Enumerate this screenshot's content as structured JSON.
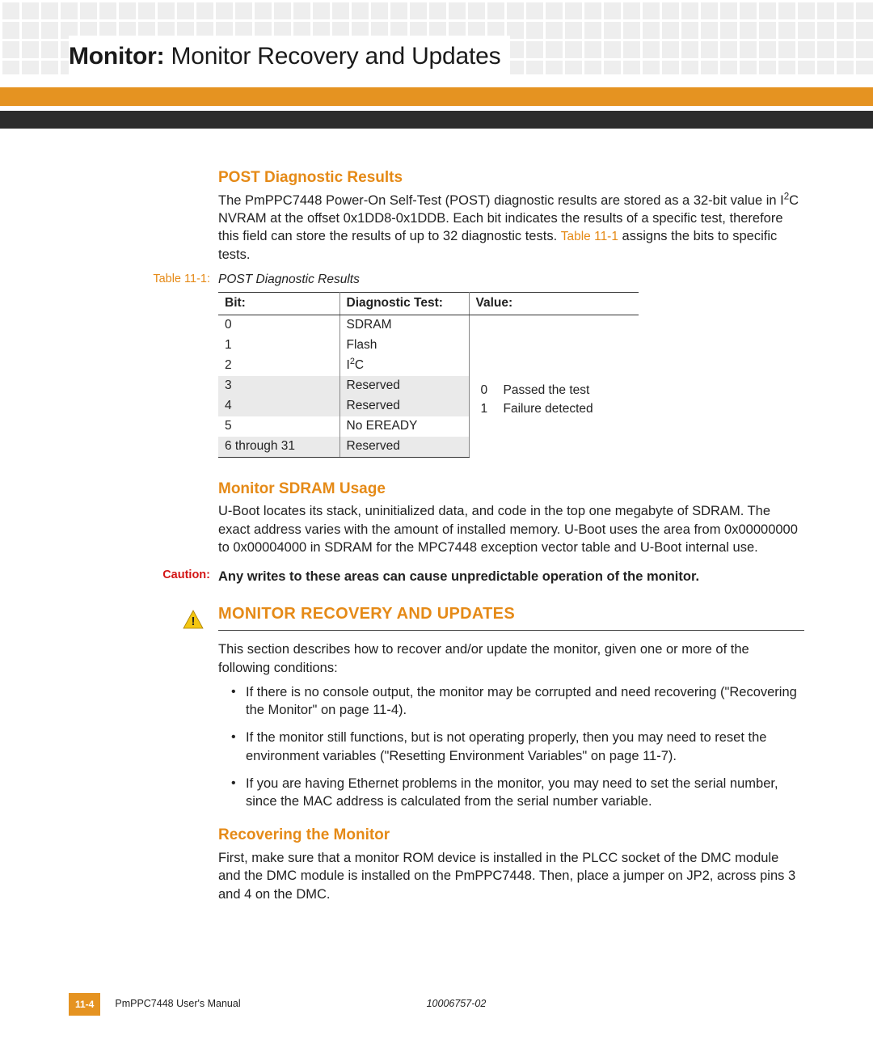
{
  "header": {
    "chapter_bold": "Monitor:",
    "chapter_light": "  Monitor Recovery and Updates"
  },
  "sections": {
    "post": {
      "title": "POST Diagnostic Results",
      "para_pre": "The PmPPC7448 Power-On Self-Test (POST) diagnostic results are stored as a 32-bit value in I",
      "para_sup": "2",
      "para_mid": "C NVRAM at the offset 0x1DD8-0x1DDB. Each bit indicates the results of a specific test, therefore this field can store the results of up to 32 diagnostic tests. ",
      "xref": "Table 11-1",
      "para_post": " assigns the bits to specific tests.",
      "table_label": "Table 11-1:",
      "table_caption": "POST Diagnostic Results",
      "headers": {
        "bit": "Bit:",
        "test": "Diagnostic Test:",
        "value": "Value:"
      },
      "rows": [
        {
          "bit": "0",
          "test": "SDRAM",
          "shade": false
        },
        {
          "bit": "1",
          "test": "Flash",
          "shade": false
        },
        {
          "bit": "2",
          "test_html": "I<sup>2</sup>C",
          "shade": false
        },
        {
          "bit": "3",
          "test": "Reserved",
          "shade": true
        },
        {
          "bit": "4",
          "test": "Reserved",
          "shade": true
        },
        {
          "bit": "5",
          "test": "No EREADY",
          "shade": false
        },
        {
          "bit": "6 through 31",
          "test": "Reserved",
          "shade": true
        }
      ],
      "values": [
        {
          "n": "0",
          "t": "Passed the test"
        },
        {
          "n": "1",
          "t": "Failure detected"
        }
      ]
    },
    "sdram": {
      "title": "Monitor SDRAM Usage",
      "para": "U-Boot locates its stack, uninitialized data, and code in the top one megabyte of SDRAM. The exact address varies with the amount of installed memory. U-Boot uses the area from 0x00000000 to 0x00004000 in SDRAM for the MPC7448 exception vector table and U-Boot internal use."
    },
    "caution": {
      "label": "Caution:",
      "text": "Any writes to these areas can cause unpredictable operation of the monitor."
    },
    "recovery": {
      "title": "MONITOR RECOVERY AND UPDATES",
      "intro": "This section describes how to recover and/or update the monitor, given one or more of the following conditions:",
      "bullets": [
        "If there is no console output, the monitor may be corrupted and need recovering (\"Recovering the Monitor\" on page 11-4).",
        "If the monitor still functions, but is not operating properly, then you may need to reset the environment variables (\"Resetting Environment Variables\" on page 11-7).",
        "If you are having Ethernet problems in the monitor, you may need to set the serial number, since the MAC address is calculated from the serial number variable."
      ]
    },
    "recover_sub": {
      "title": "Recovering the Monitor",
      "para": "First, make sure that a monitor ROM device is installed in the PLCC socket of the DMC module and the DMC module is installed on the PmPPC7448. Then, place a jumper on JP2, across pins 3 and 4 on the DMC."
    }
  },
  "footer": {
    "page": "11-4",
    "manual": "PmPPC7448 User's Manual",
    "docnum": "10006757-02"
  }
}
